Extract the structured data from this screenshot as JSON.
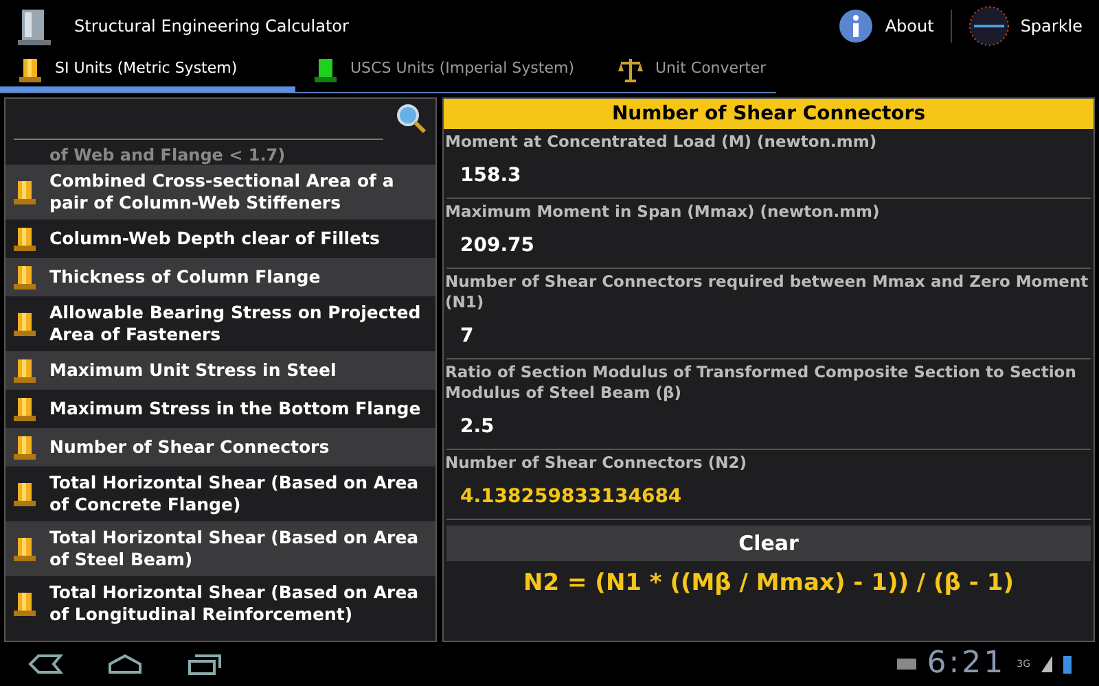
{
  "app_bar": {
    "title": "Structural Engineering Calculator",
    "actions": [
      "About",
      "Sparkle"
    ]
  },
  "tabs": [
    {
      "label": "SI Units (Metric System)",
      "selected": true
    },
    {
      "label": "USCS Units (Imperial System)",
      "selected": false
    },
    {
      "label": "Unit Converter",
      "selected": false
    }
  ],
  "sidebar": {
    "partial_item": "of Web and Flange < 1.7)",
    "items": [
      "Combined Cross-sectional Area of a pair of Column-Web Stiffeners",
      "Column-Web Depth clear of Fillets",
      "Thickness of Column Flange",
      "Allowable Bearing Stress on Projected Area of Fasteners",
      "Maximum Unit Stress in Steel",
      "Maximum Stress in the Bottom Flange",
      "Number of Shear Connectors",
      "Total Horizontal Shear (Based on Area of Concrete Flange)",
      "Total Horizontal Shear (Based on Area of Steel Beam)",
      "Total Horizontal Shear (Based on Area of Longitudinal Reinforcement)"
    ]
  },
  "calculator": {
    "title": "Number of Shear Connectors",
    "fields": [
      {
        "kind": "input",
        "label": "Moment at Concentrated Load (M) (newton.mm)",
        "value": "158.3"
      },
      {
        "kind": "input",
        "label": "Maximum Moment in Span (Mmax) (newton.mm)",
        "value": "209.75"
      },
      {
        "kind": "input",
        "label": "Number of Shear Connectors required between Mmax and Zero Moment (N1)",
        "value": "7"
      },
      {
        "kind": "input",
        "label": "Ratio of Section Modulus of Transformed Composite Section to Section Modulus of Steel Beam (β)",
        "value": "2.5"
      },
      {
        "kind": "result",
        "label": "Number of Shear Connectors (N2)",
        "value": "4.138259833134684"
      }
    ],
    "button": "Clear",
    "formula": "N2 =  (N1 * ((Mβ / Mmax) - 1)) / (β - 1)"
  },
  "status_bar": {
    "time": "6:21",
    "network": "3G"
  }
}
